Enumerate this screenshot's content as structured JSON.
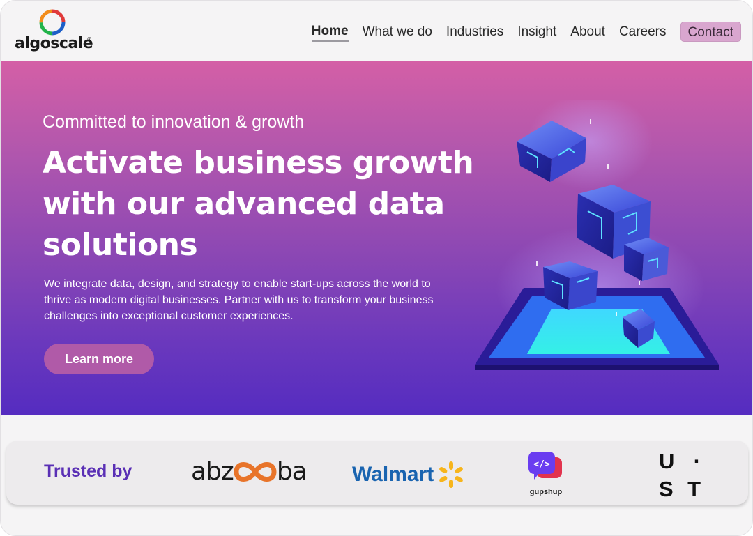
{
  "brand": {
    "name": "algoscale",
    "registered": "®"
  },
  "nav": {
    "items": [
      {
        "label": "Home",
        "active": true
      },
      {
        "label": "What we do"
      },
      {
        "label": "Industries"
      },
      {
        "label": "Insight"
      },
      {
        "label": "About"
      },
      {
        "label": "Careers"
      }
    ],
    "contact": "Contact"
  },
  "hero": {
    "kicker": "Committed to innovation & growth",
    "title": "Activate business growth with our advanced data solutions",
    "description": "We integrate data, design, and strategy to enable start-ups across the world to thrive as modern digital businesses. Partner with us to transform your business challenges into exceptional customer experiences.",
    "cta": "Learn more",
    "illustration": "data-cubes-illustration"
  },
  "trusted": {
    "label": "Trusted by",
    "logos": {
      "abzooba": {
        "left": "abz",
        "right": "ba"
      },
      "walmart": "Walmart",
      "gupshup": "gupshup",
      "ust": {
        "row1": [
          "U",
          "·"
        ],
        "row2": [
          "S",
          "T"
        ]
      }
    }
  },
  "colors": {
    "hero_top": "#d45fa6",
    "hero_bottom": "#552cc0",
    "contact_bg": "#d9a6cf",
    "trusted_text": "#5a2fb5",
    "walmart_blue": "#1a64b0",
    "walmart_spark": "#f7b51c"
  }
}
